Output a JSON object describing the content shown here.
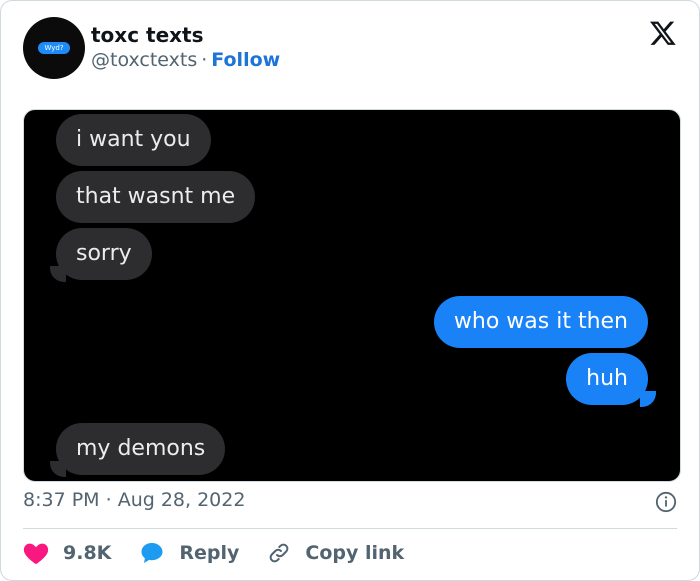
{
  "header": {
    "display_name": "toxc texts",
    "handle": "@toxctexts",
    "separator": "·",
    "follow_label": "Follow",
    "avatar_text": "Wyd?"
  },
  "media": {
    "messages": [
      {
        "side": "incoming",
        "text": "i want you"
      },
      {
        "side": "incoming",
        "text": "that wasnt me"
      },
      {
        "side": "incoming",
        "text": "sorry"
      },
      {
        "side": "outgoing",
        "text": "who was it then"
      },
      {
        "side": "outgoing",
        "text": "huh"
      },
      {
        "side": "incoming",
        "text": "my demons"
      }
    ]
  },
  "footer": {
    "time": "8:37 PM",
    "separator": "·",
    "date": "Aug 28, 2022",
    "likes": "9.8K",
    "reply_label": "Reply",
    "copy_link_label": "Copy link"
  },
  "colors": {
    "like_red": "#f91880",
    "reply_blue": "#1d9bf0",
    "follow_blue": "#1d75d8",
    "outgoing_bubble": "#1a82f7",
    "incoming_bubble": "#2d2d2f"
  },
  "icons": [
    "x-logo-icon",
    "info-icon",
    "heart-icon",
    "reply-bubble-icon",
    "link-icon"
  ]
}
